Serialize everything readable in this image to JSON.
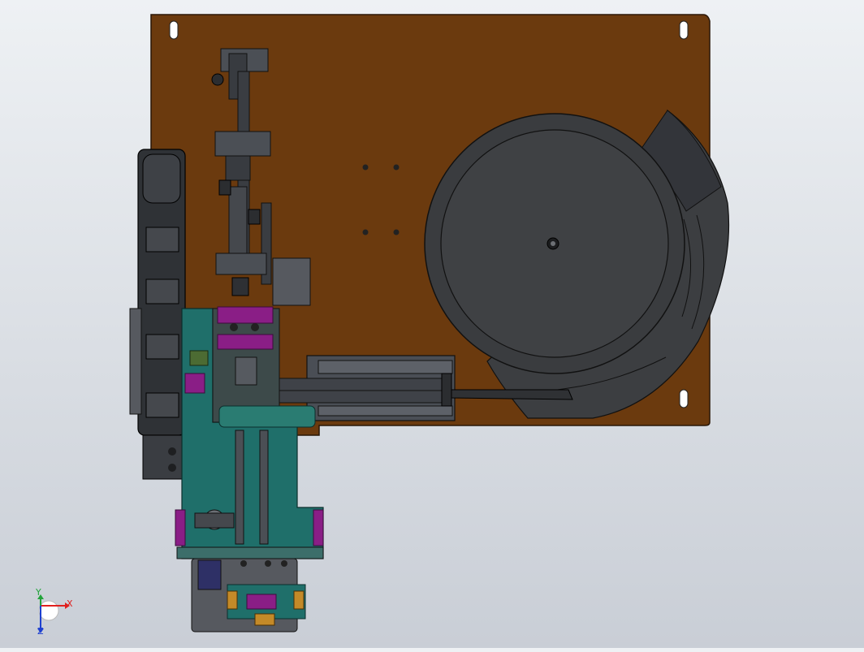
{
  "viewport": {
    "background": [
      "#eef1f4",
      "#c9ced6"
    ],
    "model_colors": {
      "base_plate": "#6b3a0e",
      "feeder_bowl": "#3a3c3f",
      "frame_teal": "#1f6f6a",
      "clamp_magenta": "#8a1e86",
      "mechanism_dark": "#4b4f55",
      "belt_dark": "#2f3236"
    },
    "components": [
      "base-plate",
      "vibratory-feeder-bowl",
      "linear-feeder-track",
      "vertical-cylinder-assembly",
      "conveyor-belt-module",
      "teal-slide-frame",
      "bottom-gripper-unit"
    ]
  },
  "triad": {
    "x_label": "X",
    "y_label": "Y",
    "z_label": "Z",
    "x_color": "#e0201f",
    "y_color": "#22a33a",
    "z_color": "#1e40d0"
  }
}
